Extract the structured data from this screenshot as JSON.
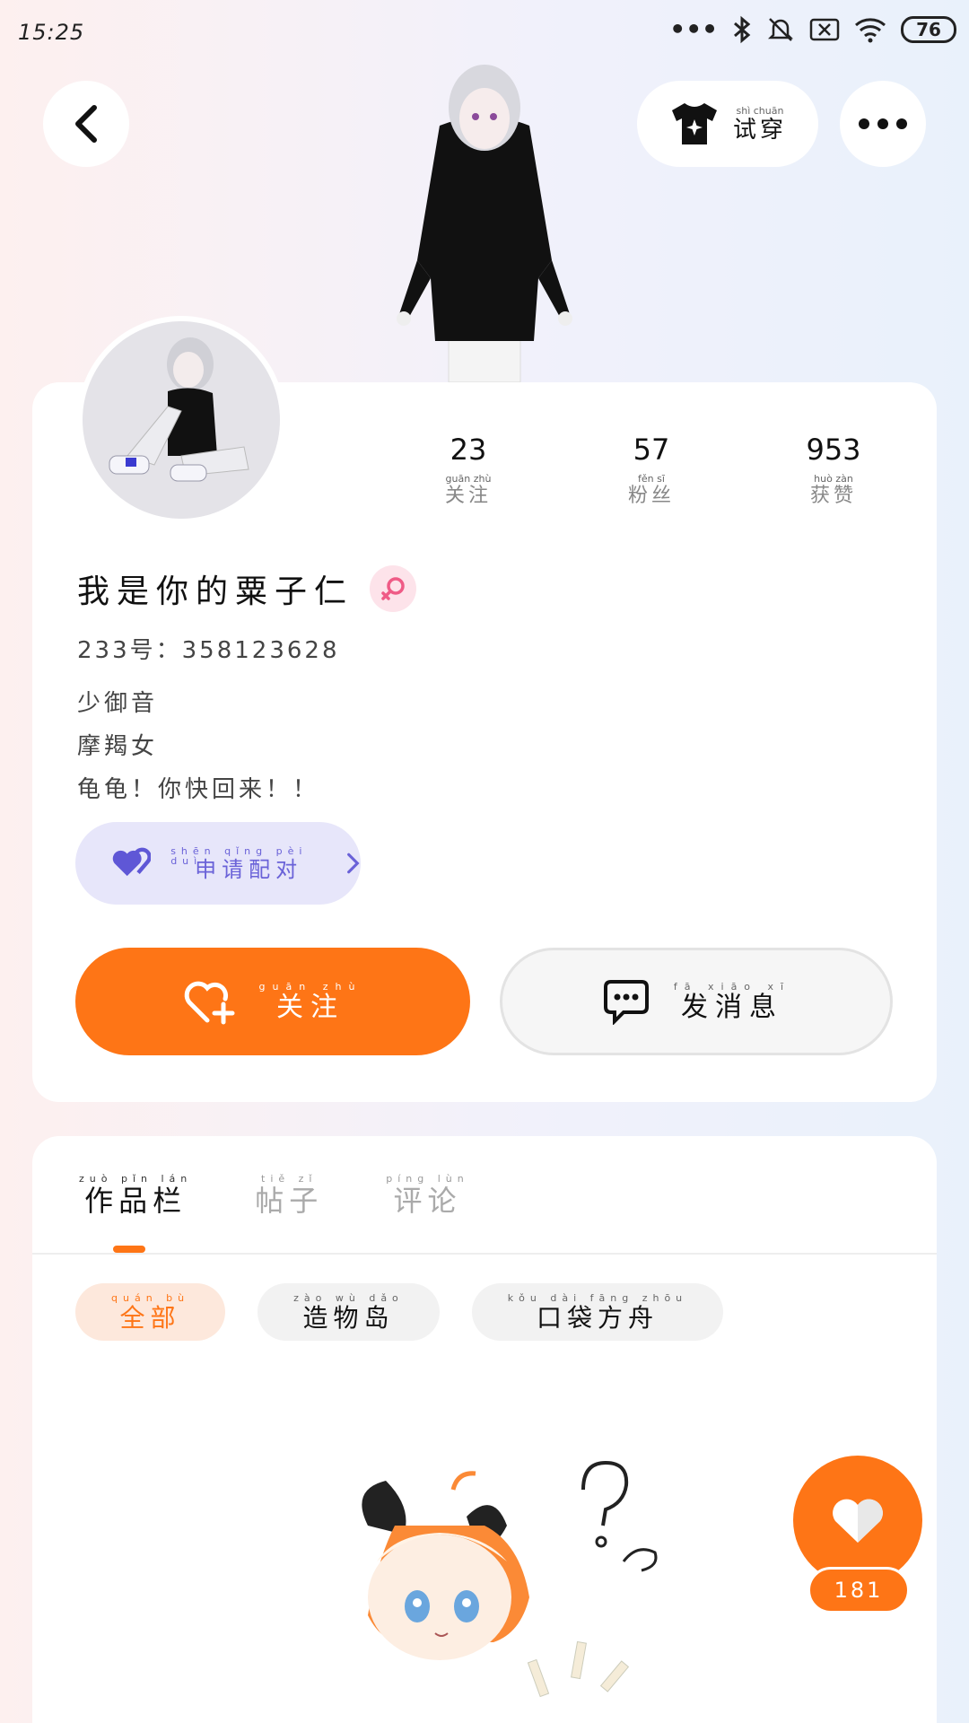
{
  "status_bar": {
    "time": "15:25",
    "battery": "76"
  },
  "header": {
    "try_on_label": "试穿",
    "try_on_pinyin": "shì chuān"
  },
  "stats": [
    {
      "value": "23",
      "label": "关注",
      "pinyin": "guān zhù"
    },
    {
      "value": "57",
      "label": "粉丝",
      "pinyin": "fěn sī"
    },
    {
      "value": "953",
      "label": "获赞",
      "pinyin": "huò zàn"
    }
  ],
  "profile": {
    "name": "我是你的粟子仁",
    "uid": "233号：358123628",
    "bio": [
      "少御音",
      "摩羯女",
      "龟龟！你快回来！！"
    ]
  },
  "pair_button": {
    "label": "申请配对",
    "pinyin": "shēn qǐng pèi duì"
  },
  "actions": {
    "follow_label": "关注",
    "follow_pinyin": "guān zhù",
    "message_label": "发消息",
    "message_pinyin": "fā xiāo xī"
  },
  "tabs": [
    {
      "label": "作品栏",
      "pinyin": "zuò pǐn lán"
    },
    {
      "label": "帖子",
      "pinyin": "tiě zǐ"
    },
    {
      "label": "评论",
      "pinyin": "píng lùn"
    }
  ],
  "filters": [
    {
      "label": "全部",
      "pinyin": "quán bù"
    },
    {
      "label": "造物岛",
      "pinyin": "zào wù dǎo"
    },
    {
      "label": "口袋方舟",
      "pinyin": "kǒu dài fāng zhōu"
    }
  ],
  "likes": {
    "count": "181"
  },
  "colors": {
    "accent": "#fe7516",
    "pair_bg": "#e7e6fa",
    "pair_text": "#6a62d8",
    "gender_bg": "#fde3ea"
  }
}
